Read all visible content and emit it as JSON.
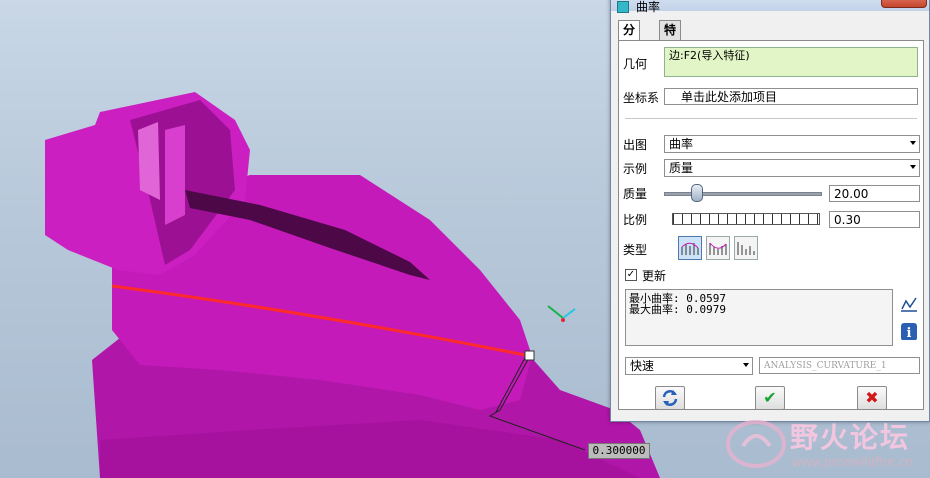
{
  "viewport": {
    "curvature_readout": "0.300000",
    "colors": {
      "part": "#c018b8",
      "part_dark": "#8e0e86",
      "curve": "#ff2a2a"
    }
  },
  "dialog": {
    "title": "曲率",
    "tabs": [
      {
        "label": "分析"
      },
      {
        "label": "特征"
      }
    ],
    "geometry": {
      "label": "几何",
      "value": "边:F2(导入特征)"
    },
    "coord_system": {
      "label": "坐标系",
      "button": "单击此处添加项目"
    },
    "plot": {
      "label": "出图",
      "value": "曲率"
    },
    "display": {
      "label": "示例",
      "value": "质量"
    },
    "quality": {
      "label": "质量",
      "value": "20.00",
      "fraction": 0.2
    },
    "scale": {
      "label": "比例",
      "value": "0.30"
    },
    "type": {
      "label": "类型"
    },
    "update": {
      "label": "更新",
      "checked": true
    },
    "results": {
      "min": "最小曲率: 0.0597",
      "max": "最大曲率: 0.0979"
    },
    "mode": {
      "value": "快速"
    },
    "analysis_name": "ANALYSIS_CURVATURE_1",
    "buttons": {
      "repeat": "repeat-icon",
      "ok": "✔",
      "cancel": "✖"
    }
  },
  "watermark": {
    "text": "野火论坛",
    "url": "www.proewildfire.cn"
  }
}
